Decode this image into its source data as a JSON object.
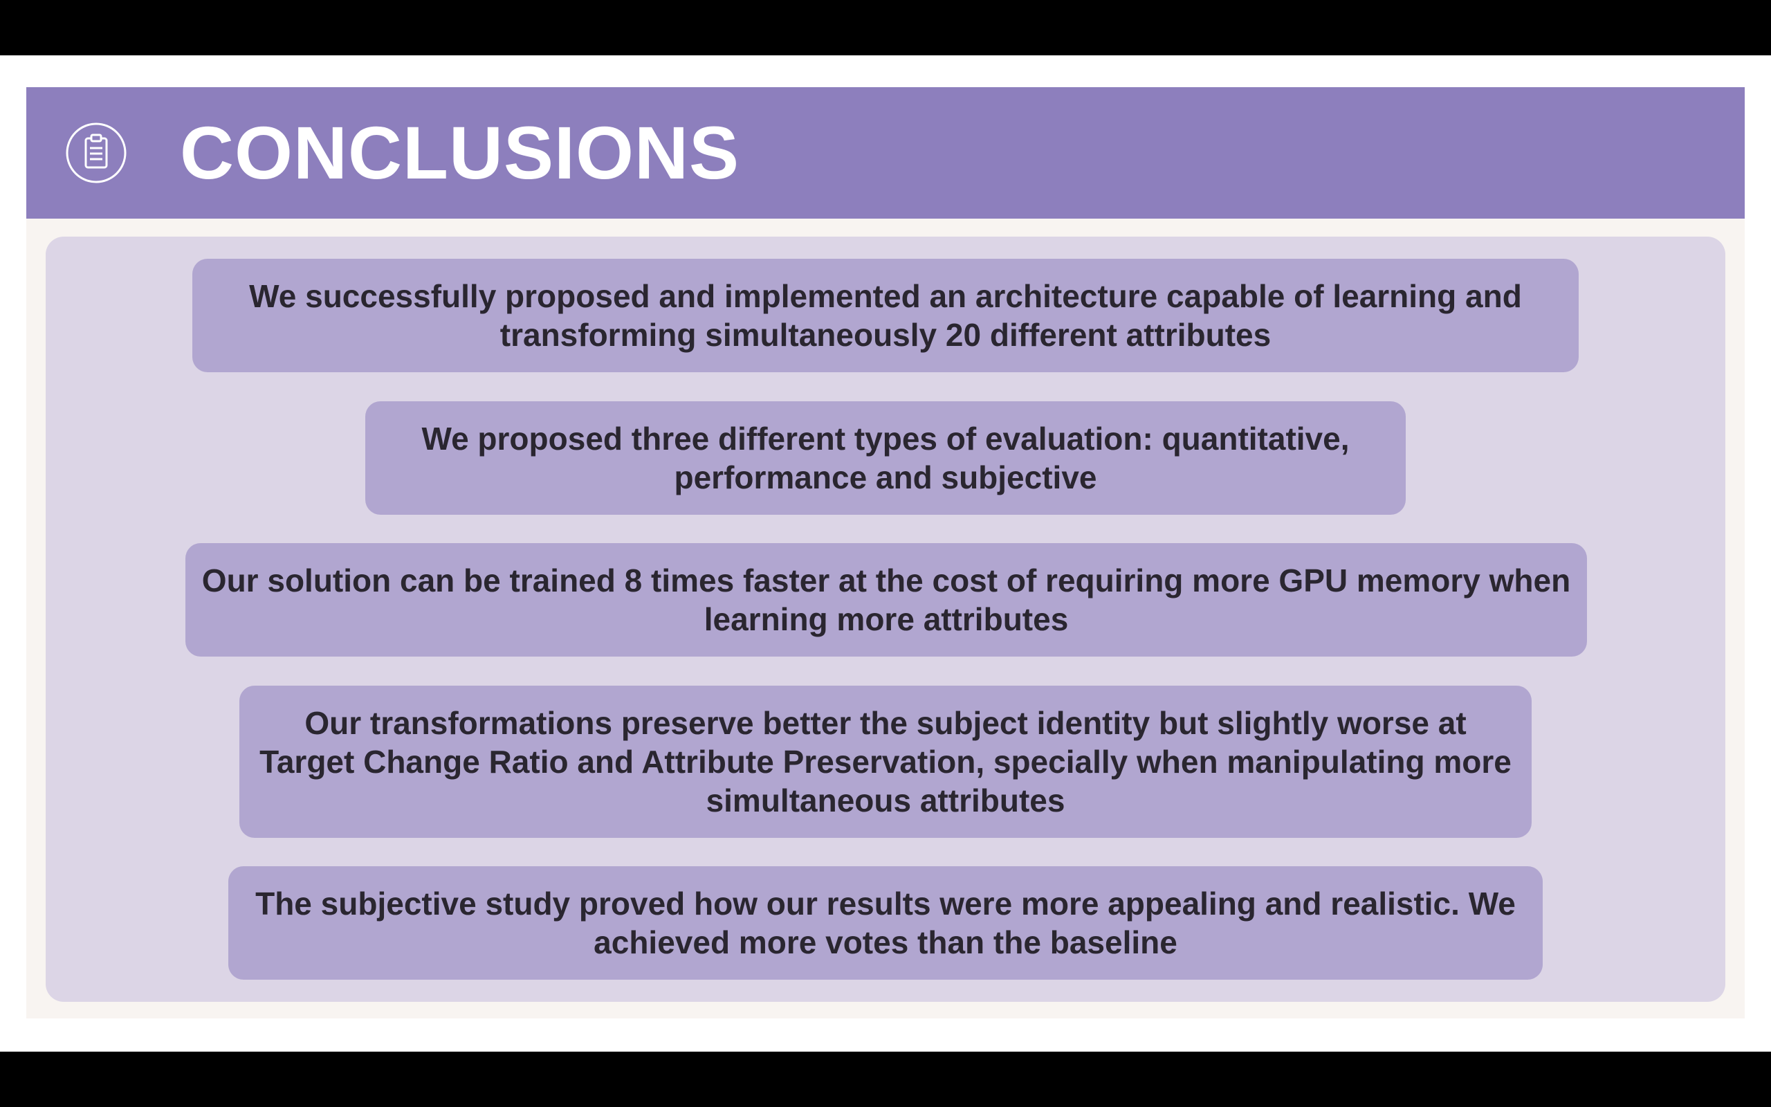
{
  "header": {
    "icon": "clipboard-icon",
    "title": "CONCLUSIONS",
    "band_color": "#8d7fbd"
  },
  "conclusions": [
    {
      "text": "We successfully proposed and implemented an architecture capable of learning and transforming simultaneously 20 different attributes"
    },
    {
      "text": "We proposed three different types of evaluation: quantitative, performance and subjective"
    },
    {
      "text": "Our solution can be trained 8 times faster at the cost of requiring more GPU memory when learning more attributes"
    },
    {
      "text": "Our transformations preserve better the subject identity but slightly worse at Target Change Ratio and Attribute Preservation, specially when manipulating more simultaneous attributes"
    },
    {
      "text": "The subjective study proved how our results were more appealing and realistic. We achieved more votes than the baseline"
    }
  ],
  "colors": {
    "panel": "#dcd5e6",
    "bullet_box": "#b1a6d0",
    "text": "#2a2630"
  }
}
